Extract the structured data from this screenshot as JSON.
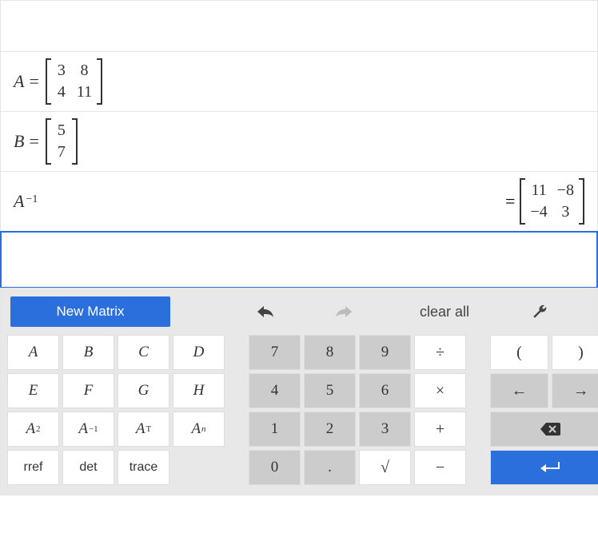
{
  "equations": {
    "A": {
      "var": "A",
      "matrix": [
        [
          "3",
          "8"
        ],
        [
          "4",
          "11"
        ]
      ]
    },
    "B": {
      "var": "B",
      "matrix": [
        [
          "5"
        ],
        [
          "7"
        ]
      ]
    },
    "Ainv": {
      "var": "A",
      "exp": "−1",
      "result": [
        [
          "11",
          "−8"
        ],
        [
          "−4",
          "3"
        ]
      ]
    }
  },
  "toolbar": {
    "new_matrix": "New Matrix",
    "clear_all": "clear all"
  },
  "keys": {
    "letters": [
      "A",
      "B",
      "C",
      "D",
      "E",
      "F",
      "G",
      "H"
    ],
    "powers": {
      "sq": "2",
      "inv": "−1",
      "T": "T",
      "n": "n"
    },
    "funcs": [
      "rref",
      "det",
      "trace"
    ],
    "nums": [
      "7",
      "8",
      "9",
      "4",
      "5",
      "6",
      "1",
      "2",
      "3",
      "0",
      "."
    ],
    "sqrt": "√",
    "ops": {
      "div": "÷",
      "mul": "×",
      "add": "+",
      "sub": "−"
    },
    "paren": {
      "l": "(",
      "r": ")"
    },
    "arrows": {
      "left": "←",
      "right": "→"
    }
  }
}
